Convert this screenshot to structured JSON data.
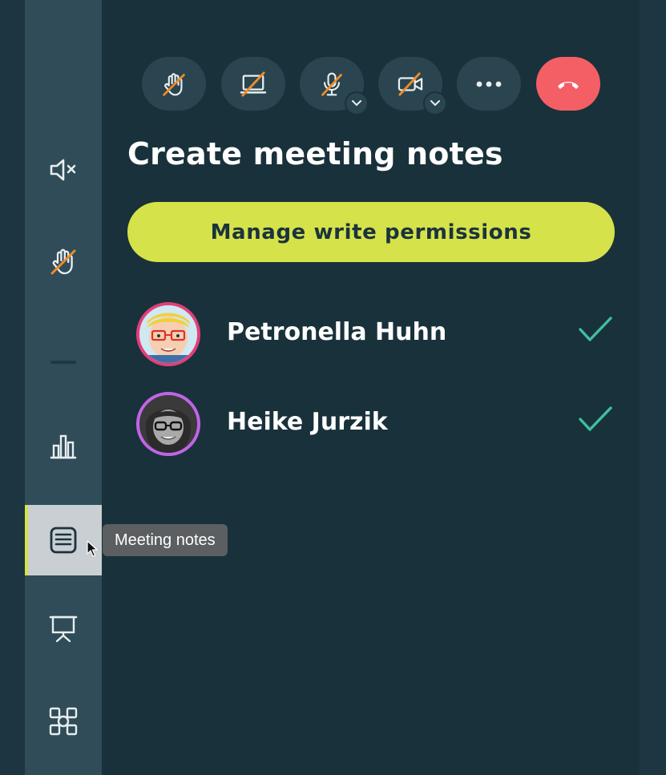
{
  "controls": [
    {
      "name": "raise-hand",
      "icon": "hand-off-icon"
    },
    {
      "name": "screen-share",
      "icon": "screen-share-off-icon"
    },
    {
      "name": "microphone",
      "icon": "mic-off-icon",
      "has_menu": true
    },
    {
      "name": "camera",
      "icon": "camera-off-icon",
      "has_menu": true
    },
    {
      "name": "more",
      "icon": "more-dots-icon"
    },
    {
      "name": "hang-up",
      "icon": "phone-hangup-icon",
      "color": "#f45f66"
    }
  ],
  "sidebar": {
    "items": [
      {
        "name": "mute-all",
        "icon": "speaker-mute-icon"
      },
      {
        "name": "lower-hands",
        "icon": "hand-off-icon"
      },
      {
        "name": "polls",
        "icon": "bar-chart-icon"
      },
      {
        "name": "meeting-notes",
        "icon": "notes-icon",
        "active": true
      },
      {
        "name": "presentation",
        "icon": "presentation-board-icon"
      },
      {
        "name": "apps",
        "icon": "apps-grid-icon"
      }
    ],
    "tooltip": "Meeting notes"
  },
  "panel": {
    "title": "Create meeting notes",
    "permissions_button": "Manage write permissions"
  },
  "participants": [
    {
      "name": "Petronella Huhn",
      "ring_color": "#e0407a",
      "status_icon": "check-icon"
    },
    {
      "name": "Heike Jurzik",
      "ring_color": "#c164e8",
      "status_icon": "check-icon"
    }
  ],
  "colors": {
    "accent": "#d5e24a",
    "background": "#19313b",
    "check": "#3fbf9f",
    "strike": "#f28c28"
  }
}
